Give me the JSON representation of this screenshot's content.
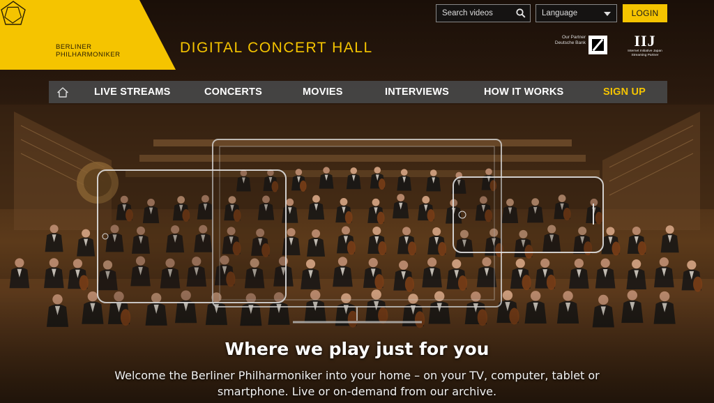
{
  "brand": {
    "logo_lines": [
      "BERLINER",
      "PHILHARMONIKER"
    ],
    "site_title": "DIGITAL CONCERT HALL",
    "accent_color": "#f5c400"
  },
  "topbar": {
    "search": {
      "placeholder": "Search videos",
      "icon": "search-icon"
    },
    "language": {
      "label": "Language",
      "icon": "chevron-down-icon"
    },
    "login_label": "LOGIN"
  },
  "partners": {
    "partner_lines": [
      "Our Partner",
      "Deutsche Bank"
    ],
    "iij_mark": "IIJ",
    "iij_lines": [
      "Internet Initiative Japan",
      "Streaming Partner"
    ]
  },
  "nav": {
    "home_icon": "home-icon",
    "items": [
      {
        "label": "LIVE STREAMS"
      },
      {
        "label": "CONCERTS"
      },
      {
        "label": "MOVIES"
      },
      {
        "label": "INTERVIEWS"
      },
      {
        "label": "HOW IT WORKS"
      }
    ],
    "signup_label": "SIGN UP"
  },
  "hero": {
    "headline": "Where we play just for you",
    "subtext": "Welcome the Berliner Philharmoniker into your home – on your TV, computer, tablet or smartphone. Live or on-demand from our archive."
  }
}
